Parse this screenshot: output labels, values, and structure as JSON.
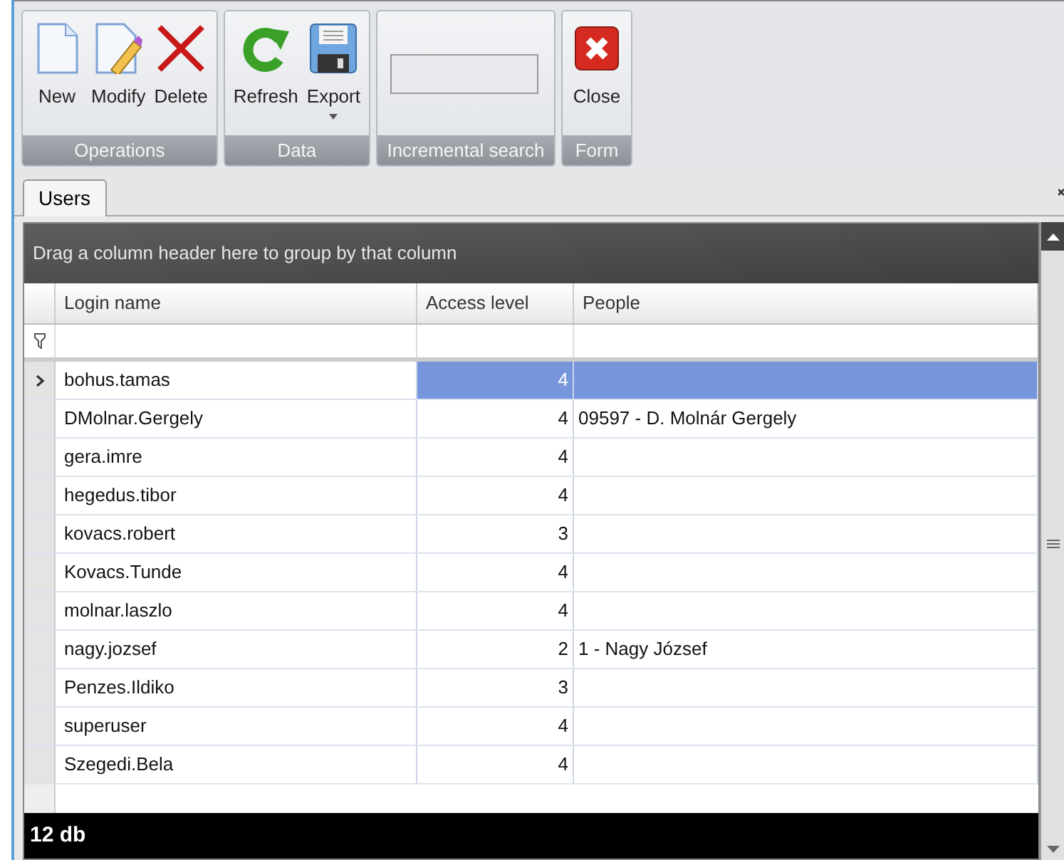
{
  "ribbon": {
    "groups": [
      {
        "caption": "Operations",
        "buttons": [
          {
            "label": "New",
            "kind": "new"
          },
          {
            "label": "Modify",
            "kind": "modify"
          },
          {
            "label": "Delete",
            "kind": "delete"
          }
        ]
      },
      {
        "caption": "Data",
        "buttons": [
          {
            "label": "Refresh",
            "kind": "refresh"
          },
          {
            "label": "Export",
            "kind": "export",
            "dropdown": true
          }
        ]
      },
      {
        "caption": "Incremental search",
        "kind": "search"
      },
      {
        "caption": "Form",
        "buttons": [
          {
            "label": "Close",
            "kind": "close"
          }
        ]
      }
    ]
  },
  "tabs": [
    {
      "label": "Users",
      "selected": true
    }
  ],
  "grid": {
    "group_panel": "Drag a column header here to group by that column",
    "columns": [
      "Login name",
      "Access level",
      "People"
    ],
    "rows": [
      {
        "login": "bohus.tamas",
        "access": "4",
        "people": "",
        "selected": true
      },
      {
        "login": "DMolnar.Gergely",
        "access": "4",
        "people": "09597 - D. Molnár Gergely",
        "selected": false
      },
      {
        "login": "gera.imre",
        "access": "4",
        "people": "",
        "selected": false
      },
      {
        "login": "hegedus.tibor",
        "access": "4",
        "people": "",
        "selected": false
      },
      {
        "login": "kovacs.robert",
        "access": "3",
        "people": "",
        "selected": false
      },
      {
        "login": "Kovacs.Tunde",
        "access": "4",
        "people": "",
        "selected": false
      },
      {
        "login": "molnar.laszlo",
        "access": "4",
        "people": "",
        "selected": false
      },
      {
        "login": "nagy.jozsef",
        "access": "2",
        "people": "1 - Nagy József",
        "selected": false
      },
      {
        "login": "Penzes.Ildiko",
        "access": "3",
        "people": "",
        "selected": false
      },
      {
        "login": "superuser",
        "access": "4",
        "people": "",
        "selected": false
      },
      {
        "login": "Szegedi.Bela",
        "access": "4",
        "people": "",
        "selected": false
      }
    ],
    "footer": "12 db"
  }
}
